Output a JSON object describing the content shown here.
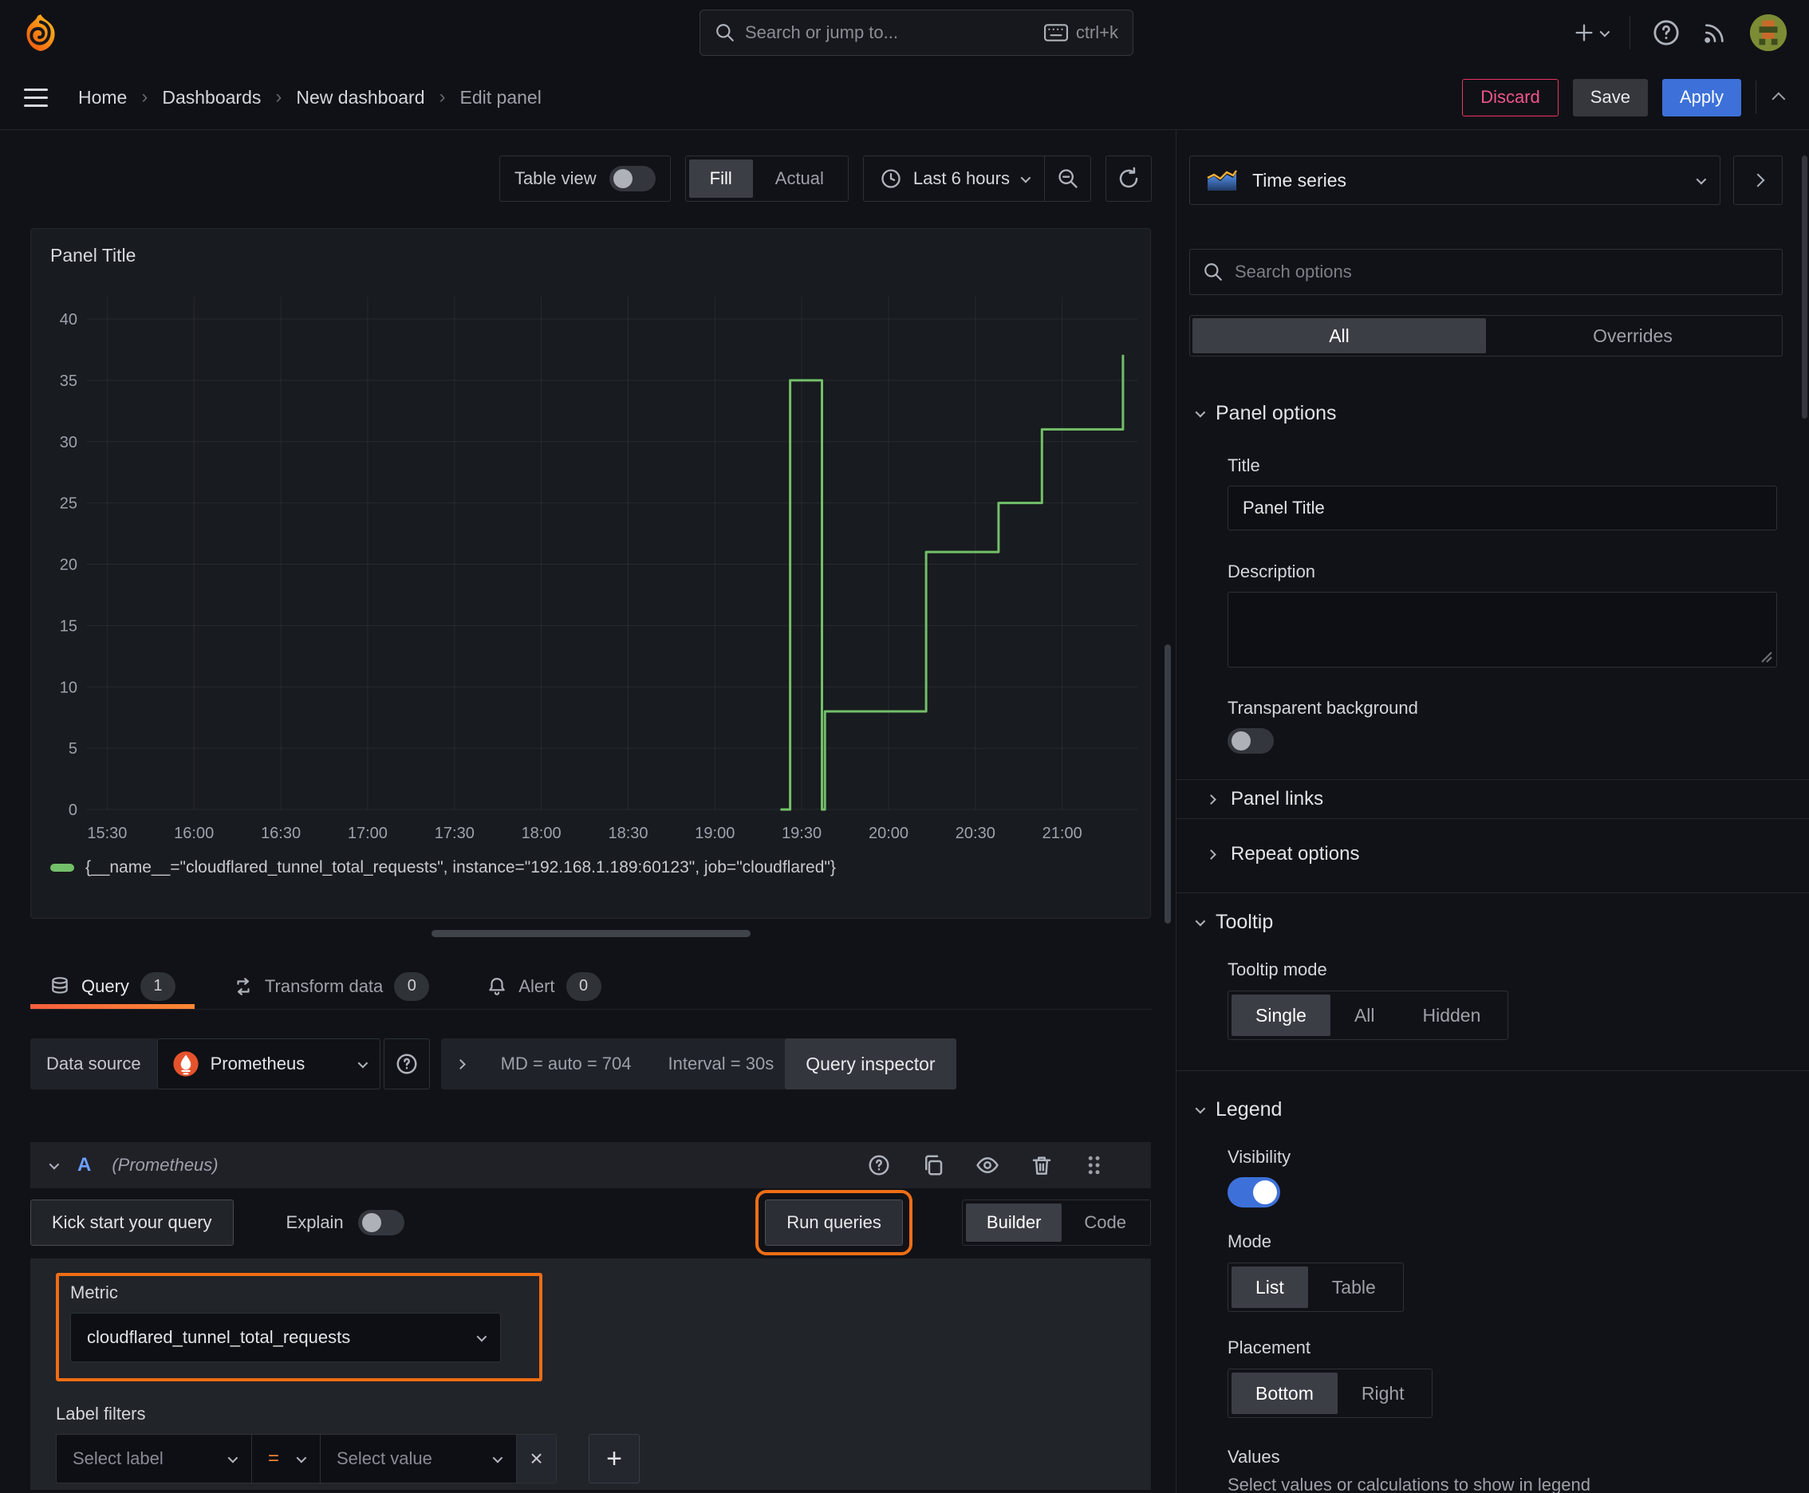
{
  "colors": {
    "accent_orange": "#ee6d15",
    "tab_underline_from": "#f55f3e",
    "tab_underline_to": "#ff8833",
    "primary_blue": "#3d71d9",
    "series_green": "#73bf69",
    "destructive_pink": "#e63565"
  },
  "topbar": {
    "search_placeholder": "Search or jump to...",
    "shortcut": "ctrl+k"
  },
  "breadcrumb": {
    "items": [
      "Home",
      "Dashboards",
      "New dashboard",
      "Edit panel"
    ]
  },
  "header_actions": {
    "discard": "Discard",
    "save": "Save",
    "apply": "Apply"
  },
  "toolbar": {
    "table_view_label": "Table view",
    "display_options": [
      "Fill",
      "Actual"
    ],
    "display_selected": "Fill",
    "time_range": "Last 6 hours"
  },
  "panel": {
    "title": "Panel Title"
  },
  "chart_data": {
    "type": "line",
    "title": "Panel Title",
    "x_ticks": [
      "15:30",
      "16:00",
      "16:30",
      "17:00",
      "17:30",
      "18:00",
      "18:30",
      "19:00",
      "19:30",
      "20:00",
      "20:30",
      "21:00"
    ],
    "y_ticks": [
      0,
      5,
      10,
      15,
      20,
      25,
      30,
      35,
      40
    ],
    "ylim": [
      0,
      40
    ],
    "x_range_minutes": [
      923,
      1286
    ],
    "grid": true,
    "legend_position": "bottom",
    "series": [
      {
        "name": "{__name__=\"cloudflared_tunnel_total_requests\", instance=\"192.168.1.189:60123\", job=\"cloudflared\"}",
        "color": "#73bf69",
        "points": [
          [
            "19:23",
            0
          ],
          [
            "19:26",
            0
          ],
          [
            "19:26",
            35
          ],
          [
            "19:37",
            35
          ],
          [
            "19:37",
            0
          ],
          [
            "19:38",
            0
          ],
          [
            "19:38",
            8
          ],
          [
            "20:13",
            8
          ],
          [
            "20:13",
            21
          ],
          [
            "20:38",
            21
          ],
          [
            "20:38",
            25
          ],
          [
            "20:53",
            25
          ],
          [
            "20:53",
            31
          ],
          [
            "21:21",
            31
          ],
          [
            "21:21",
            37
          ]
        ]
      }
    ]
  },
  "editor_tabs": [
    {
      "label": "Query",
      "count": "1"
    },
    {
      "label": "Transform data",
      "count": "0"
    },
    {
      "label": "Alert",
      "count": "0"
    }
  ],
  "datasource": {
    "label": "Data source",
    "name": "Prometheus",
    "stats_md": "MD = auto = 704",
    "stats_interval": "Interval = 30s",
    "inspector_label": "Query inspector"
  },
  "query_row": {
    "ref_id": "A",
    "datasource_hint": "(Prometheus)"
  },
  "query_toolbar": {
    "kickstart": "Kick start your query",
    "explain": "Explain",
    "run": "Run queries",
    "mode_options": [
      "Builder",
      "Code"
    ],
    "mode_selected": "Builder"
  },
  "builder": {
    "metric_label": "Metric",
    "metric_value": "cloudflared_tunnel_total_requests",
    "label_filters_label": "Label filters",
    "select_label_placeholder": "Select label",
    "operator": "=",
    "select_value_placeholder": "Select value"
  },
  "sidebar": {
    "viz_name": "Time series",
    "search_placeholder": "Search options",
    "filter_tabs": [
      "All",
      "Overrides"
    ],
    "filter_selected": "All",
    "panel_options": {
      "header": "Panel options",
      "title_label": "Title",
      "title_value": "Panel Title",
      "description_label": "Description",
      "transparent_label": "Transparent background",
      "transparent_on": false
    },
    "collapsed": [
      "Panel links",
      "Repeat options"
    ],
    "tooltip": {
      "header": "Tooltip",
      "mode_label": "Tooltip mode",
      "options": [
        "Single",
        "All",
        "Hidden"
      ],
      "selected": "Single"
    },
    "legend": {
      "header": "Legend",
      "visibility_label": "Visibility",
      "visibility_on": true,
      "mode_label": "Mode",
      "mode_options": [
        "List",
        "Table"
      ],
      "mode_selected": "List",
      "placement_label": "Placement",
      "placement_options": [
        "Bottom",
        "Right"
      ],
      "placement_selected": "Bottom",
      "values_label": "Values",
      "values_hint": "Select values or calculations to show in legend"
    }
  }
}
